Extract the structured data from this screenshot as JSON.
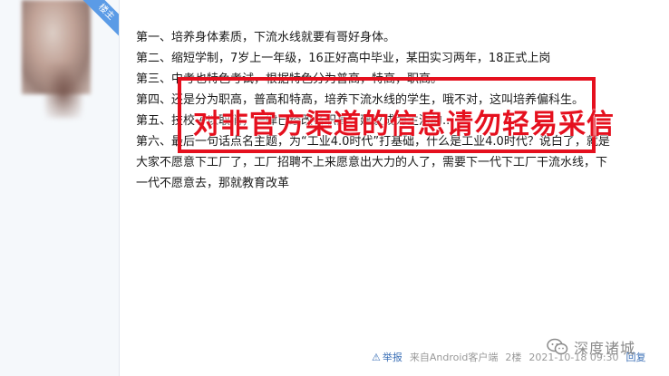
{
  "badge": "楼主",
  "post": {
    "lines": [
      "第一、培养身体素质，下流水线就要有哥好身体。",
      "第二、缩短学制，7岁上一年级，16正好高中毕业，某田实习两年，18正式上岗",
      "第三、中考也特色考试，根据特色分为普高，特高，职高。",
      "第四、还是分为职高，普高和特高，培养下流水线的学生，哦不对，这叫培养偏科生。",
      "第五、技校子以取消，一律已经改名职高，建议成为主流的...",
      "第六、最后一句话点名主题，为“工业4.0时代”打基础，什么是工业4.0时代？说白了，就是",
      "大家不愿意下工厂了，工厂招聘不上来愿意出大力的人了，需要下一代下工厂干流水线，下",
      "一代不愿意去，那就教育改革"
    ]
  },
  "watermark": "对非官方渠道的信息请勿轻易采信",
  "footer": {
    "report": "举报",
    "source": "来自Android客户端",
    "floor": "2楼",
    "time": "2021-10-18 09:30",
    "reply": "回复"
  },
  "logo": {
    "text": "深度诸城"
  }
}
